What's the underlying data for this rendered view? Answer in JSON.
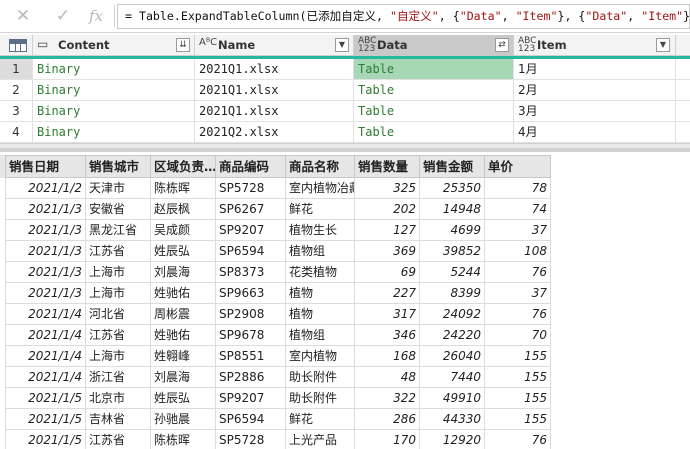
{
  "formula_bar": {
    "cancel_glyph": "✕",
    "confirm_glyph": "✓",
    "fx_glyph": "fx",
    "formula_prefix": "= Table.ExpandTableColumn(已添加自定义, ",
    "formula_arg1": "\"自定义\"",
    "formula_sep1": ", {",
    "formula_arg2": "\"Data\"",
    "formula_sep2": ", ",
    "formula_arg3": "\"Item\"",
    "formula_sep3": "}, {",
    "formula_arg4": "\"Data\"",
    "formula_sep4": ", ",
    "formula_arg5": "\"Item\"",
    "formula_suffix": "})"
  },
  "query_grid": {
    "columns": [
      {
        "name": "Content",
        "type_icon": "binary-icon",
        "type_label": "▭"
      },
      {
        "name": "Name",
        "type_icon": "text-type-icon",
        "type_label": "AᴮC"
      },
      {
        "name": "Data",
        "type_icon": "any-type-icon",
        "type_label": "ABC 123"
      },
      {
        "name": "Item",
        "type_icon": "any-type-icon",
        "type_label": "ABC 123"
      }
    ],
    "rows": [
      {
        "num": "1",
        "content": "Binary",
        "name": "2021Q1.xlsx",
        "data": "Table",
        "item": "1月"
      },
      {
        "num": "2",
        "content": "Binary",
        "name": "2021Q1.xlsx",
        "data": "Table",
        "item": "2月"
      },
      {
        "num": "3",
        "content": "Binary",
        "name": "2021Q1.xlsx",
        "data": "Table",
        "item": "3月"
      },
      {
        "num": "4",
        "content": "Binary",
        "name": "2021Q2.xlsx",
        "data": "Table",
        "item": "4月"
      }
    ],
    "accent_color": "#27b99e",
    "selected_cell_color": "#a6d8b5"
  },
  "sheet": {
    "headers": [
      "销售日期",
      "销售城市",
      "区域负责人",
      "商品编码",
      "商品名称",
      "销售数量",
      "销售金额",
      "单价"
    ],
    "header_visible": [
      "销售日期",
      "销售城市",
      "区域负责…",
      "商品编码",
      "商品名称",
      "销售数量",
      "销售金额",
      "单价"
    ],
    "rows": [
      [
        "2021/1/2",
        "天津市",
        "陈栋晖",
        "SP5728",
        "室内植物冶藏",
        "325",
        "25350",
        "78"
      ],
      [
        "2021/1/3",
        "安徽省",
        "赵辰枫",
        "SP6267",
        "鲜花",
        "202",
        "14948",
        "74"
      ],
      [
        "2021/1/3",
        "黑龙江省",
        "吴成颜",
        "SP9207",
        "植物生长",
        "127",
        "4699",
        "37"
      ],
      [
        "2021/1/3",
        "江苏省",
        "姓辰弘",
        "SP6594",
        "植物组",
        "369",
        "39852",
        "108"
      ],
      [
        "2021/1/3",
        "上海市",
        "刘晨海",
        "SP8373",
        "花类植物",
        "69",
        "5244",
        "76"
      ],
      [
        "2021/1/3",
        "上海市",
        "姓驰佑",
        "SP9663",
        "植物",
        "227",
        "8399",
        "37"
      ],
      [
        "2021/1/4",
        "河北省",
        "周彬震",
        "SP2908",
        "植物",
        "317",
        "24092",
        "76"
      ],
      [
        "2021/1/4",
        "江苏省",
        "姓驰佑",
        "SP9678",
        "植物组",
        "346",
        "24220",
        "70"
      ],
      [
        "2021/1/4",
        "上海市",
        "姓翱峰",
        "SP8551",
        "室内植物",
        "168",
        "26040",
        "155"
      ],
      [
        "2021/1/4",
        "浙江省",
        "刘晨海",
        "SP2886",
        "助长附件",
        "48",
        "7440",
        "155"
      ],
      [
        "2021/1/5",
        "北京市",
        "姓辰弘",
        "SP9207",
        "助长附件",
        "322",
        "49910",
        "155"
      ],
      [
        "2021/1/5",
        "吉林省",
        "孙驰晨",
        "SP6594",
        "鲜花",
        "286",
        "44330",
        "155"
      ],
      [
        "2021/1/5",
        "江苏省",
        "陈栋晖",
        "SP5728",
        "上光产品",
        "170",
        "12920",
        "76"
      ]
    ]
  }
}
